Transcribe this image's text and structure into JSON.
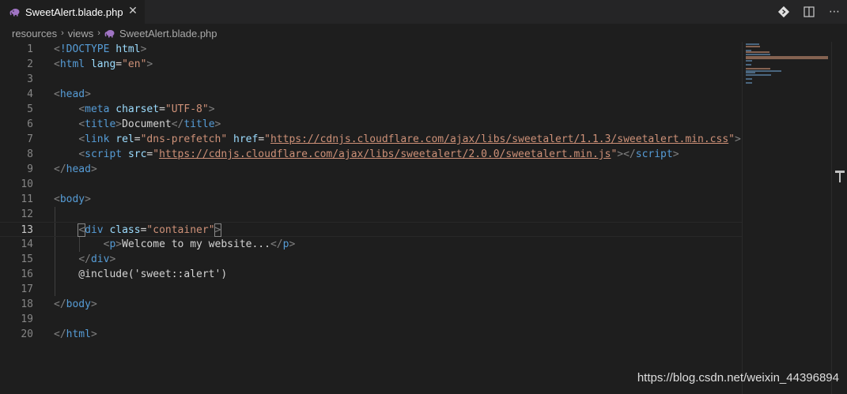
{
  "tab": {
    "label": "SweetAlert.blade.php",
    "close": "✕",
    "icon": "php-elephant-icon"
  },
  "toolbar": {
    "icons": [
      "git-compare-icon",
      "split-editor-icon",
      "more-actions-icon"
    ],
    "more": "⋯"
  },
  "breadcrumb": {
    "items": [
      "resources",
      "views",
      "SweetAlert.blade.php"
    ]
  },
  "editor": {
    "active_line": 13,
    "lines": [
      {
        "n": "1",
        "tokens": [
          [
            "punc",
            "<"
          ],
          [
            "doctype",
            "!DOCTYPE"
          ],
          [
            "text",
            " "
          ],
          [
            "attr",
            "html"
          ],
          [
            "punc",
            ">"
          ]
        ]
      },
      {
        "n": "2",
        "tokens": [
          [
            "punc",
            "<"
          ],
          [
            "tag",
            "html"
          ],
          [
            "text",
            " "
          ],
          [
            "attr",
            "lang"
          ],
          [
            "text",
            "="
          ],
          [
            "str",
            "\"en\""
          ],
          [
            "punc",
            ">"
          ]
        ]
      },
      {
        "n": "3",
        "tokens": []
      },
      {
        "n": "4",
        "tokens": [
          [
            "punc",
            "<"
          ],
          [
            "tag",
            "head"
          ],
          [
            "punc",
            ">"
          ]
        ]
      },
      {
        "n": "5",
        "tokens": [
          [
            "text",
            "    "
          ],
          [
            "punc",
            "<"
          ],
          [
            "tag",
            "meta"
          ],
          [
            "text",
            " "
          ],
          [
            "attr",
            "charset"
          ],
          [
            "text",
            "="
          ],
          [
            "str",
            "\"UTF-8\""
          ],
          [
            "punc",
            ">"
          ]
        ]
      },
      {
        "n": "6",
        "tokens": [
          [
            "text",
            "    "
          ],
          [
            "punc",
            "<"
          ],
          [
            "tag",
            "title"
          ],
          [
            "punc",
            ">"
          ],
          [
            "text",
            "Document"
          ],
          [
            "punc",
            "</"
          ],
          [
            "tag",
            "title"
          ],
          [
            "punc",
            ">"
          ]
        ]
      },
      {
        "n": "7",
        "tokens": [
          [
            "text",
            "    "
          ],
          [
            "punc",
            "<"
          ],
          [
            "tag",
            "link"
          ],
          [
            "text",
            " "
          ],
          [
            "attr",
            "rel"
          ],
          [
            "text",
            "="
          ],
          [
            "str",
            "\"dns-prefetch\""
          ],
          [
            "text",
            " "
          ],
          [
            "attr",
            "href"
          ],
          [
            "text",
            "="
          ],
          [
            "str",
            "\""
          ],
          [
            "url",
            "https://cdnjs.cloudflare.com/ajax/libs/sweetalert/1.1.3/sweetalert.min.css"
          ],
          [
            "str",
            "\""
          ],
          [
            "punc",
            ">"
          ]
        ]
      },
      {
        "n": "8",
        "tokens": [
          [
            "text",
            "    "
          ],
          [
            "punc",
            "<"
          ],
          [
            "tag",
            "script"
          ],
          [
            "text",
            " "
          ],
          [
            "attr",
            "src"
          ],
          [
            "text",
            "="
          ],
          [
            "str",
            "\""
          ],
          [
            "url",
            "https://cdnjs.cloudflare.com/ajax/libs/sweetalert/2.0.0/sweetalert.min.js"
          ],
          [
            "str",
            "\""
          ],
          [
            "punc",
            "></"
          ],
          [
            "tag",
            "script"
          ],
          [
            "punc",
            ">"
          ]
        ]
      },
      {
        "n": "9",
        "tokens": [
          [
            "punc",
            "</"
          ],
          [
            "tag",
            "head"
          ],
          [
            "punc",
            ">"
          ]
        ]
      },
      {
        "n": "10",
        "tokens": []
      },
      {
        "n": "11",
        "tokens": [
          [
            "punc",
            "<"
          ],
          [
            "tag",
            "body"
          ],
          [
            "punc",
            ">"
          ]
        ]
      },
      {
        "n": "12",
        "tokens": []
      },
      {
        "n": "13",
        "tokens": [
          [
            "text",
            "    "
          ],
          [
            "punc",
            "<"
          ],
          [
            "tag",
            "div"
          ],
          [
            "text",
            " "
          ],
          [
            "attr",
            "class"
          ],
          [
            "text",
            "="
          ],
          [
            "str",
            "\"container\""
          ],
          [
            "punc",
            ">"
          ]
        ]
      },
      {
        "n": "14",
        "tokens": [
          [
            "text",
            "        "
          ],
          [
            "punc",
            "<"
          ],
          [
            "tag",
            "p"
          ],
          [
            "punc",
            ">"
          ],
          [
            "text",
            "Welcome to my website..."
          ],
          [
            "punc",
            "</"
          ],
          [
            "tag",
            "p"
          ],
          [
            "punc",
            ">"
          ]
        ]
      },
      {
        "n": "15",
        "tokens": [
          [
            "text",
            "    "
          ],
          [
            "punc",
            "</"
          ],
          [
            "tag",
            "div"
          ],
          [
            "punc",
            ">"
          ]
        ]
      },
      {
        "n": "16",
        "tokens": [
          [
            "text",
            "    @include('sweet::alert')"
          ]
        ]
      },
      {
        "n": "17",
        "tokens": []
      },
      {
        "n": "18",
        "tokens": [
          [
            "punc",
            "</"
          ],
          [
            "tag",
            "body"
          ],
          [
            "punc",
            ">"
          ]
        ]
      },
      {
        "n": "19",
        "tokens": []
      },
      {
        "n": "20",
        "tokens": [
          [
            "punc",
            "</"
          ],
          [
            "tag",
            "html"
          ],
          [
            "punc",
            ">"
          ]
        ]
      }
    ]
  },
  "watermark": "https://blog.csdn.net/weixin_44396894",
  "colors": {
    "background": "#1e1e1e",
    "tag": "#569cd6",
    "attr": "#9cdcfe",
    "string": "#ce9178",
    "punctuation": "#808080"
  }
}
